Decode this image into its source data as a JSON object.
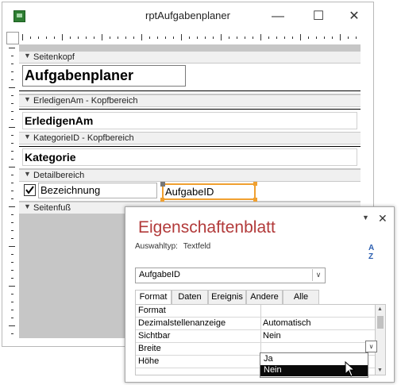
{
  "window": {
    "title": "rptAufgabenplaner",
    "minimize_glyph": "—",
    "maximize_glyph": "☐",
    "close_glyph": "✕"
  },
  "report": {
    "sections": {
      "page_header": "Seitenkopf",
      "group1_header": "ErledigenAm - Kopfbereich",
      "group2_header": "KategorieID - Kopfbereich",
      "detail": "Detailbereich",
      "page_footer": "Seitenfuß"
    },
    "controls": {
      "title_label": "Aufgabenplaner",
      "erledigen_field": "ErledigenAm",
      "kategorie_field": "Kategorie",
      "bezeichnung_field": "Bezeichnung",
      "aufgabe_field": "AufgabeID"
    },
    "checkbox_checked": true
  },
  "property_sheet": {
    "title": "Eigenschaftenblatt",
    "selection_type_label": "Auswahltyp:",
    "selection_type_value": "Textfeld",
    "selected_object": "AufgabeID",
    "sort_icon_glyph": "A↓Z",
    "tabs": [
      "Format",
      "Daten",
      "Ereignis",
      "Andere",
      "Alle"
    ],
    "active_tab": "Format",
    "rows": [
      {
        "name": "Format",
        "value": ""
      },
      {
        "name": "Dezimalstellenanzeige",
        "value": "Automatisch"
      },
      {
        "name": "Sichtbar",
        "value": "Nein"
      },
      {
        "name": "Breite",
        "value": ""
      },
      {
        "name": "Höhe",
        "value": ""
      }
    ],
    "dropdown_options": [
      "Ja",
      "Nein"
    ],
    "dropdown_selected": "Nein"
  },
  "colors": {
    "title_accent": "#b23a3a",
    "window_border": "#b8b8b8",
    "section_bar": "#f0f0f0",
    "selected_control": "#f0a030"
  }
}
